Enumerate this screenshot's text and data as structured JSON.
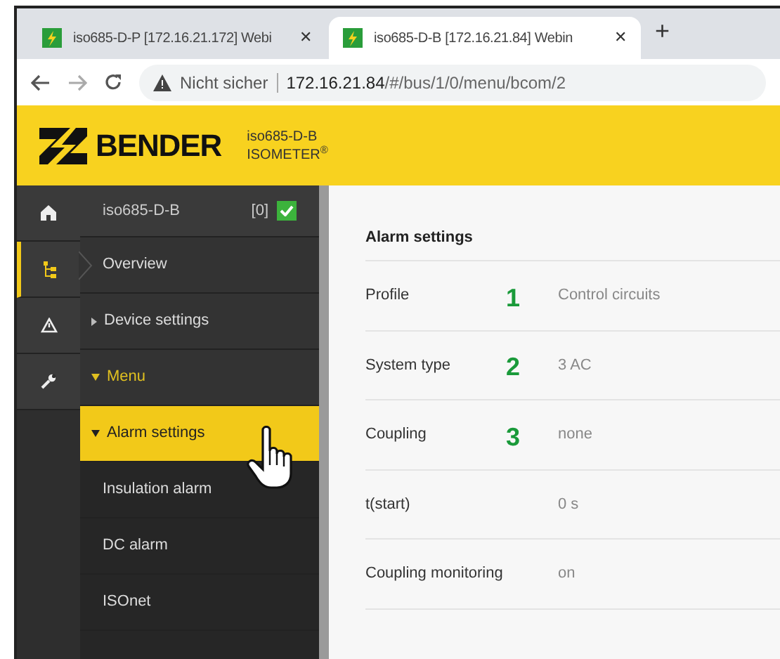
{
  "browser": {
    "tabs": [
      {
        "title": "iso685-D-P [172.16.21.172] Webi",
        "selected": false,
        "close": "✕"
      },
      {
        "title": "iso685-D-B [172.16.21.84] Webin",
        "selected": true,
        "close": "✕"
      }
    ],
    "new_tab": "+",
    "security": "Nicht sicher",
    "url_host": "172.16.21.84",
    "url_path": "/#/bus/1/0/menu/bcom/2"
  },
  "header": {
    "brand": "BENDER",
    "device": "iso685-D-B",
    "product": "ISOMETER$^{®}$"
  },
  "rail": [
    {
      "kind": "home",
      "selected": false
    },
    {
      "kind": "tree",
      "selected": true
    },
    {
      "kind": "warning",
      "selected": false
    },
    {
      "kind": "wrench",
      "selected": false
    }
  ],
  "device": {
    "name": "iso685-D-B",
    "count": "[0]",
    "ok": true
  },
  "nav": [
    {
      "label": "Overview",
      "kind": "current",
      "selected": false
    },
    {
      "label": "Device settings",
      "kind": "expander",
      "expanded": false,
      "selected": false
    },
    {
      "label": "Menu",
      "kind": "group",
      "expanded": true,
      "selected": false
    },
    {
      "label": "Alarm settings",
      "kind": "expander",
      "expanded": true,
      "selected": true
    },
    {
      "label": "Insulation alarm",
      "kind": "link",
      "selected": false
    },
    {
      "label": "DC alarm",
      "kind": "link",
      "selected": false
    },
    {
      "label": "ISOnet",
      "kind": "link",
      "selected": false
    },
    {
      "kind": "partial",
      "selected": false
    }
  ],
  "content": {
    "title": "Alarm settings",
    "rows": [
      {
        "label": "Profile",
        "callout": "1",
        "value": "Control circuits"
      },
      {
        "label": "System type",
        "callout": "2",
        "value": "3 AC"
      },
      {
        "label": "Coupling",
        "callout": "3",
        "value": "none"
      },
      {
        "label": "t(start)",
        "value": "0 s"
      },
      {
        "label": "Coupling monitoring",
        "value": "on"
      }
    ]
  }
}
